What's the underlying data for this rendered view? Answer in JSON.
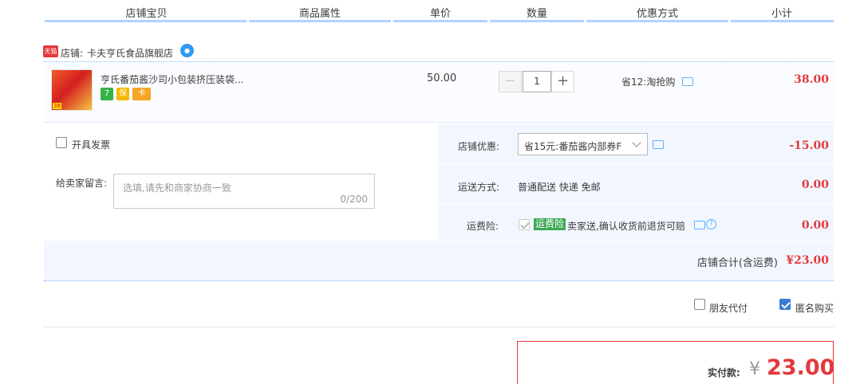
{
  "header": {
    "columns": [
      "店铺宝贝",
      "商品属性",
      "单价",
      "数量",
      "优惠方式",
      "小计"
    ]
  },
  "shop": {
    "badge": "天猫",
    "prefix": "店铺:",
    "name": "卡夫亨氏食品旗舰店",
    "ww_icon": "wangwang-chat-icon"
  },
  "item": {
    "title": "亨氏番茄酱沙司小包装挤压装袋...",
    "thumb_label": "38",
    "service_icons": [
      "7",
      "保",
      "卡"
    ],
    "unit_price": "50.00",
    "quantity": "1",
    "minus": "−",
    "plus": "+",
    "discount": "省12:淘抢购",
    "subtotal": "38.00"
  },
  "options": {
    "invoice_label": "开具发票",
    "message_label": "给卖家留言:",
    "message_placeholder": "选填,请先和商家协商一致",
    "message_count": "0/200",
    "shop_discount_label": "店铺优惠:",
    "shop_discount_value": "省15元:番茄酱内部券F",
    "shop_discount_amount": "-15.00",
    "shipping_label": "运送方式:",
    "shipping_value": "普通配送 快递 免邮",
    "shipping_amount": "0.00",
    "insurance_label": "运费险:",
    "insurance_badge": "运费险",
    "insurance_text": "卖家送,确认收货前退货可赔",
    "insurance_amount": "0.00"
  },
  "shop_total": {
    "label": "店铺合计(含运费)",
    "value": "¥23.00"
  },
  "bottom": {
    "friend_pay": "朋友代付",
    "anonymous": "匿名购买"
  },
  "pay": {
    "label": "实付款:",
    "currency": "¥",
    "amount": "23.00"
  },
  "colors": {
    "accent_red": "#e4393c",
    "light_blue_bg": "#f2f7ff",
    "header_line": "#b2d1ff",
    "insurance_green": "#3ca756"
  }
}
